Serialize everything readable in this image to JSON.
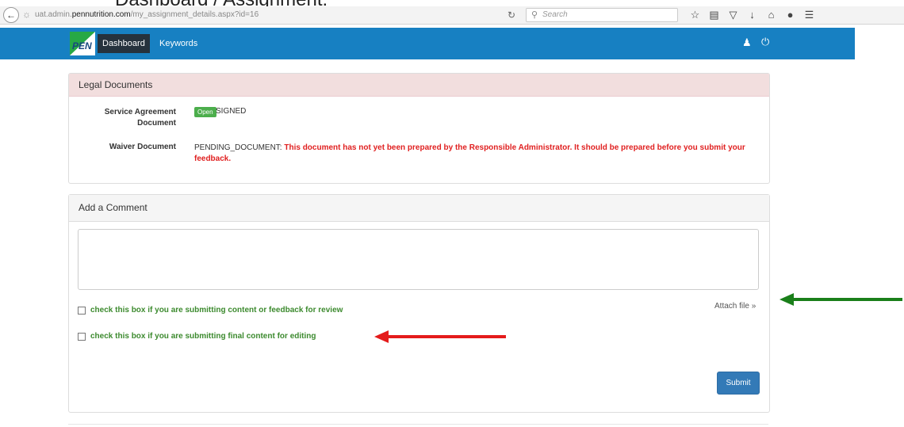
{
  "doc_title": "Dashboard / Assignment:",
  "browser": {
    "url_prefix": "uat.admin.",
    "url_domain": "pennutrition.com",
    "url_path": "/my_assignment_details.aspx?id=16",
    "search_placeholder": "Search",
    "icons": [
      "star-icon",
      "bookmarks-icon",
      "pocket-icon",
      "download-icon",
      "home-icon",
      "chat-icon",
      "menu-icon"
    ]
  },
  "navbar": {
    "logo_text": "PEN",
    "items": [
      {
        "label": "Dashboard",
        "active": true
      },
      {
        "label": "Keywords",
        "active": false
      }
    ],
    "user_icon": "user-icon",
    "power_icon": "power-icon",
    "color": "#1780c2"
  },
  "legal": {
    "title": "Legal Documents",
    "service_agreement_label": "Service Agreement Document",
    "service_agreement_button": "Open",
    "service_agreement_status": "SIGNED",
    "waiver_label": "Waiver Document",
    "waiver_status": "PENDING_DOCUMENT:",
    "waiver_warning": "This document has not yet been prepared by the Responsible Administrator. It should be prepared before you submit your feedback."
  },
  "comment": {
    "title": "Add a Comment",
    "textarea_value": "",
    "checkbox_review_label": "check this box if you are submitting content or feedback for review",
    "checkbox_review_checked": false,
    "checkbox_final_label": "check this box if you are submitting final content for editing",
    "checkbox_final_checked": false,
    "attach_label": "Attach file »",
    "submit_label": "Submit"
  },
  "colors": {
    "green_arrow": "#1a7f1a",
    "red_arrow": "#e41b1b",
    "warning_text": "#e02020",
    "checkbox_label": "#3c8a2e"
  }
}
